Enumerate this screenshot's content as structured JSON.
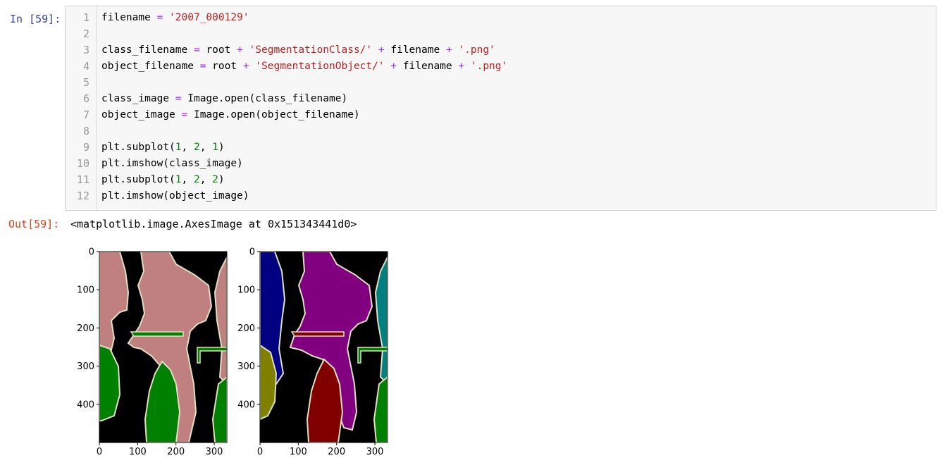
{
  "cell": {
    "in_prompt": "In [59]:",
    "out_prompt": "Out[59]:",
    "output_repr": "<matplotlib.image.AxesImage at 0x151343441d0>"
  },
  "code": {
    "line_numbers": [
      "1",
      "2",
      "3",
      "4",
      "5",
      "6",
      "7",
      "8",
      "9",
      "10",
      "11",
      "12"
    ],
    "lines": [
      [
        {
          "t": "filename ",
          "k": "var"
        },
        {
          "t": "=",
          "k": "op"
        },
        {
          "t": " ",
          "k": "var"
        },
        {
          "t": "'2007_000129'",
          "k": "str"
        }
      ],
      [],
      [
        {
          "t": "class_filename ",
          "k": "var"
        },
        {
          "t": "=",
          "k": "op"
        },
        {
          "t": " root ",
          "k": "var"
        },
        {
          "t": "+",
          "k": "op"
        },
        {
          "t": " ",
          "k": "var"
        },
        {
          "t": "'SegmentationClass/'",
          "k": "str"
        },
        {
          "t": " ",
          "k": "var"
        },
        {
          "t": "+",
          "k": "op"
        },
        {
          "t": " filename ",
          "k": "var"
        },
        {
          "t": "+",
          "k": "op"
        },
        {
          "t": " ",
          "k": "var"
        },
        {
          "t": "'.png'",
          "k": "str"
        }
      ],
      [
        {
          "t": "object_filename ",
          "k": "var"
        },
        {
          "t": "=",
          "k": "op"
        },
        {
          "t": " root ",
          "k": "var"
        },
        {
          "t": "+",
          "k": "op"
        },
        {
          "t": " ",
          "k": "var"
        },
        {
          "t": "'SegmentationObject/'",
          "k": "str"
        },
        {
          "t": " ",
          "k": "var"
        },
        {
          "t": "+",
          "k": "op"
        },
        {
          "t": " filename ",
          "k": "var"
        },
        {
          "t": "+",
          "k": "op"
        },
        {
          "t": " ",
          "k": "var"
        },
        {
          "t": "'.png'",
          "k": "str"
        }
      ],
      [],
      [
        {
          "t": "class_image ",
          "k": "var"
        },
        {
          "t": "=",
          "k": "op"
        },
        {
          "t": " Image.open(class_filename)",
          "k": "var"
        }
      ],
      [
        {
          "t": "object_image ",
          "k": "var"
        },
        {
          "t": "=",
          "k": "op"
        },
        {
          "t": " Image.open(object_filename)",
          "k": "var"
        }
      ],
      [],
      [
        {
          "t": "plt.subplot(",
          "k": "var"
        },
        {
          "t": "1",
          "k": "num"
        },
        {
          "t": ", ",
          "k": "var"
        },
        {
          "t": "2",
          "k": "num"
        },
        {
          "t": ", ",
          "k": "var"
        },
        {
          "t": "1",
          "k": "num"
        },
        {
          "t": ")",
          "k": "var"
        }
      ],
      [
        {
          "t": "plt.imshow(class_image)",
          "k": "var"
        }
      ],
      [
        {
          "t": "plt.subplot(",
          "k": "var"
        },
        {
          "t": "1",
          "k": "num"
        },
        {
          "t": ", ",
          "k": "var"
        },
        {
          "t": "2",
          "k": "num"
        },
        {
          "t": ", ",
          "k": "var"
        },
        {
          "t": "2",
          "k": "num"
        },
        {
          "t": ")",
          "k": "var"
        }
      ],
      [
        {
          "t": "plt.imshow(object_image)",
          "k": "var"
        }
      ]
    ]
  },
  "figure": {
    "y_ticks": [
      "0",
      "100",
      "200",
      "300",
      "400"
    ],
    "x_ticks": [
      "0",
      "100",
      "200",
      "300"
    ],
    "x_tick_values": [
      0,
      100,
      200,
      300
    ],
    "y_tick_values": [
      0,
      100,
      200,
      300,
      400
    ],
    "xlim": [
      0,
      333
    ],
    "ylim": [
      0,
      500
    ],
    "class_palette": {
      "background": "#000000",
      "person": "#c08080",
      "bicycle": "#008000",
      "boundary": "#e0e0c0"
    },
    "object_palette": {
      "background": "#000000",
      "obj1": "#000080",
      "obj2": "#800080",
      "obj3": "#008080",
      "obj4": "#800000",
      "obj5": "#808000",
      "obj6": "#008000",
      "boundary": "#e0e0c0"
    }
  }
}
